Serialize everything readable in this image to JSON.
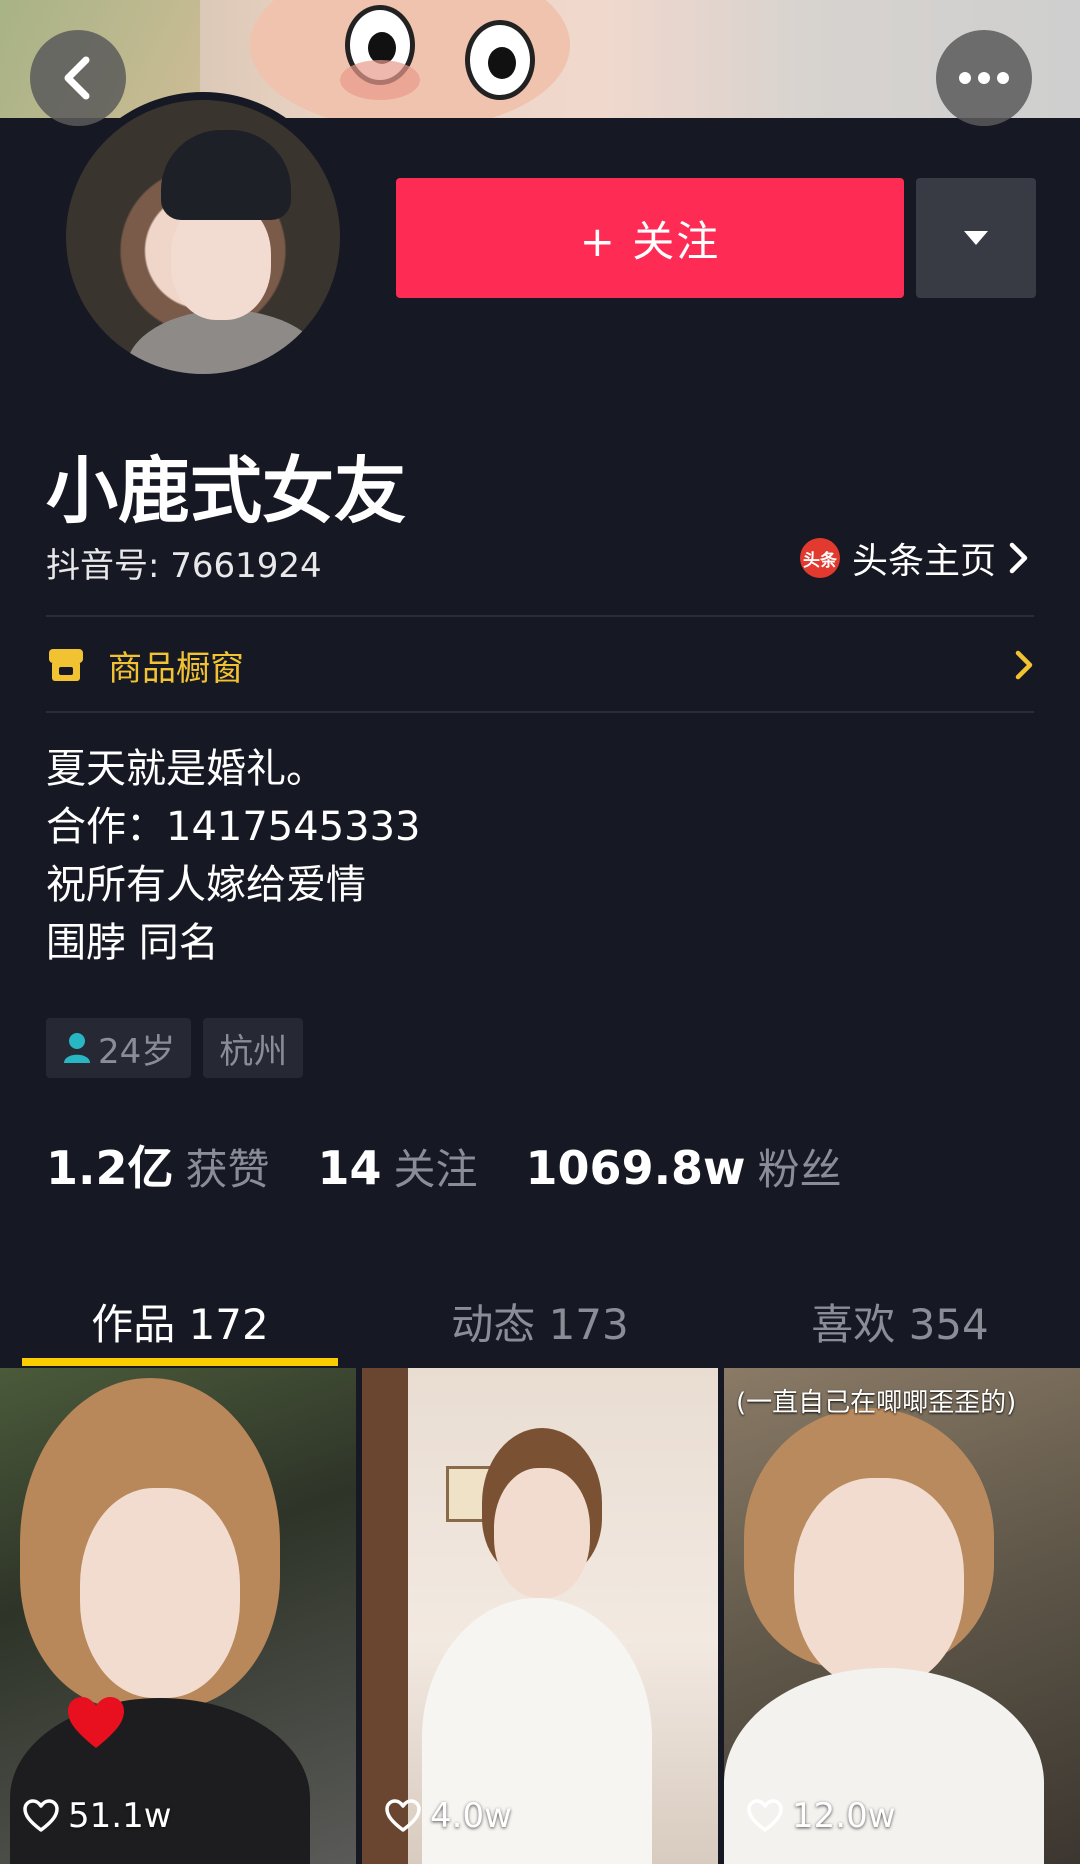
{
  "header": {
    "back_icon": "chevron-left-icon",
    "more_icon": "ellipsis-icon"
  },
  "profile": {
    "follow_label": "+ 关注",
    "nickname": "小鹿式女友",
    "douyin_id": "抖音号: 7661924",
    "toutiao_badge": "头条",
    "toutiao_label": "头条主页",
    "shop_label": "商品橱窗",
    "bio": [
      "夏天就是婚礼。",
      "合作：1417545333",
      "祝所有人嫁给爱情",
      "围脖 同名"
    ],
    "tags": {
      "age": "24岁",
      "city": "杭州"
    }
  },
  "stats": [
    {
      "num": "1.2亿",
      "label": "获赞"
    },
    {
      "num": "14",
      "label": "关注"
    },
    {
      "num": "1069.8w",
      "label": "粉丝"
    }
  ],
  "tabs": [
    {
      "label": "作品 172",
      "active": true
    },
    {
      "label": "动态 173",
      "active": false
    },
    {
      "label": "喜欢 354",
      "active": false
    }
  ],
  "videos": [
    {
      "likes": "51.1w",
      "caption": ""
    },
    {
      "likes": "4.0w",
      "caption": ""
    },
    {
      "likes": "12.0w",
      "caption": "(一直自己在唧唧歪歪的)"
    }
  ],
  "colors": {
    "background": "#161823",
    "follow": "#fe2c55",
    "tab_indicator": "#facd00",
    "shop": "#f1c232",
    "muted": "#8b8d96"
  }
}
